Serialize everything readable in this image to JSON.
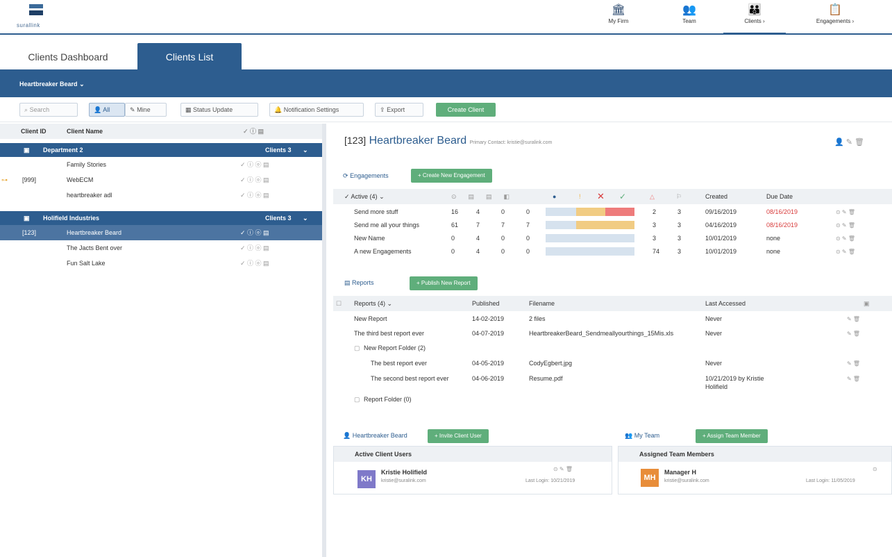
{
  "brand": {
    "name": "surallink"
  },
  "nav": [
    {
      "label": "My Firm",
      "icon": "bank-icon"
    },
    {
      "label": "Team",
      "icon": "team-icon"
    },
    {
      "label": "Clients",
      "icon": "clients-icon"
    },
    {
      "label": "Engagements",
      "icon": "engagements-icon"
    }
  ],
  "tabs": [
    "Clients Dashboard",
    "Clients List"
  ],
  "client_selector": "Heartbreaker Beard",
  "toolbar": {
    "search_placeholder": "Search",
    "all": "All",
    "mine": "Mine",
    "status_update": "Status Update",
    "notification_settings": "Notification Settings",
    "export": "Export",
    "create_client": "Create Client"
  },
  "left": {
    "headers": {
      "id": "Client ID",
      "name": "Client Name"
    },
    "groups": [
      {
        "name": "Department 2",
        "count": "Clients 3",
        "rows": [
          {
            "id": "",
            "name": "Family Stories",
            "icons": "✓ ⓘ ⓞ ▤"
          },
          {
            "id": "[999]",
            "name": "WebECM",
            "icons": "✓ ⓘ ⓞ ▤"
          },
          {
            "id": "",
            "name": "heartbreaker adl",
            "icons": "✓ ⓘ ⓞ ▤"
          }
        ]
      },
      {
        "name": "Holifield Industries",
        "count": "Clients 3",
        "rows": [
          {
            "id": "[123]",
            "name": "Heartbreaker Beard",
            "icons": "✓ ⓘ ⓞ ▤"
          },
          {
            "id": "",
            "name": "The Jacts Bent over",
            "icons": "✓ ⓘ ⓞ ▤"
          },
          {
            "id": "",
            "name": "Fun Salt Lake",
            "icons": "✓ ⓘ ⓞ ▤"
          }
        ]
      }
    ]
  },
  "detail": {
    "id": "[123]",
    "name": "Heartbreaker Beard",
    "primary_contact": "Primary Contact: kristie@suralink.com"
  },
  "engagements": {
    "title": "Engagements",
    "create": "+ Create New Engagement",
    "filter": "Active (4)",
    "headers": {
      "created": "Created",
      "due": "Due Date"
    },
    "rows": [
      {
        "name": "Send more stuff",
        "c1": "16",
        "c2": "4",
        "c3": "0",
        "c4": "0",
        "yellow": 0.33,
        "red": 0.33,
        "n1": "2",
        "n2": "3",
        "created": "09/16/2019",
        "due": "08/16/2019",
        "overdue": true
      },
      {
        "name": "Send me all your things",
        "c1": "61",
        "c2": "7",
        "c3": "7",
        "c4": "7",
        "yellow": 0.66,
        "red": 0,
        "n1": "3",
        "n2": "3",
        "created": "04/16/2019",
        "due": "08/16/2019",
        "overdue": true
      },
      {
        "name": "New Name",
        "c1": "0",
        "c2": "4",
        "c3": "0",
        "c4": "0",
        "yellow": 0,
        "red": 0,
        "n1": "3",
        "n2": "3",
        "created": "10/01/2019",
        "due": "none",
        "overdue": false
      },
      {
        "name": "A new Engagements",
        "c1": "0",
        "c2": "4",
        "c3": "0",
        "c4": "0",
        "yellow": 0,
        "red": 0,
        "n1": "74",
        "n2": "3",
        "created": "10/01/2019",
        "due": "none",
        "overdue": false
      }
    ]
  },
  "reports": {
    "title": "Reports",
    "create": "+ Publish New Report",
    "headers": {
      "name": "Reports (4)",
      "published": "Published",
      "filename": "Filename",
      "accessed": "Last Accessed"
    },
    "rows": [
      {
        "name": "New Report",
        "published": "14-02-2019",
        "filename": "2 files",
        "accessed": "Never"
      },
      {
        "name": "The third best report ever",
        "published": "04-07-2019",
        "filename": "HeartbreakerBeard_Sendmeallyourthings_15Mis.xls",
        "accessed": "Never"
      },
      {
        "name": "New Report Folder (2)",
        "published": "",
        "filename": "",
        "accessed": ""
      },
      {
        "name": "The best report ever",
        "published": "04-05-2019",
        "filename": "CodyEgbert.jpg",
        "accessed": "Never"
      },
      {
        "name": "The second best report ever",
        "published": "04-06-2019",
        "filename": "Resume.pdf",
        "accessed": "10/21/2019 by Kristie Holifield"
      },
      {
        "name": "Report Folder (0)",
        "published": "",
        "filename": "",
        "accessed": ""
      }
    ]
  },
  "client_users": {
    "section": "Heartbreaker Beard",
    "invite": "+ Invite Client User",
    "panel_title": "Active Client Users",
    "user": {
      "initials": "KH",
      "name": "Kristie Holifield",
      "email": "kristie@suralink.com",
      "last_login": "Last Login: 10/21/2019"
    }
  },
  "team": {
    "section": "My Team",
    "assign": "+ Assign Team Member",
    "panel_title": "Assigned Team Members",
    "user": {
      "initials": "MH",
      "name": "Manager H",
      "email": "kristie@suralink.com",
      "last_login": "Last Login: 11/05/2019"
    }
  },
  "colors": {
    "primary": "#2d5d8f",
    "green": "#5fae7b",
    "yellow": "#f1cc83",
    "red": "#ee7b7b",
    "avatar_kh": "#7f79c9",
    "avatar_mh": "#e88d3a"
  }
}
